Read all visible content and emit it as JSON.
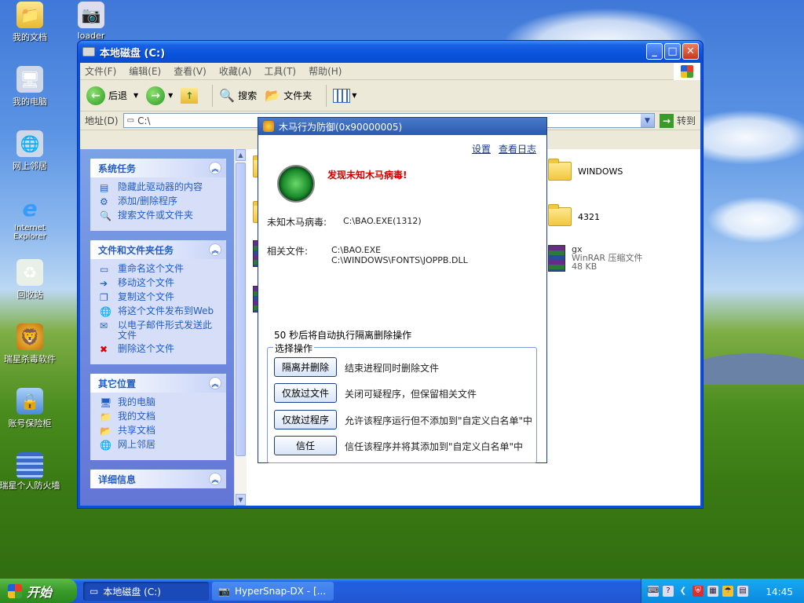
{
  "desktop": {
    "icons": [
      {
        "label": "我的文档",
        "icon": "my-documents-icon"
      },
      {
        "label": "loader",
        "icon": "loader-icon"
      },
      {
        "label": "我的电脑",
        "icon": "my-computer-icon"
      },
      {
        "label": "网上邻居",
        "icon": "network-places-icon"
      },
      {
        "label": "Internet Explorer",
        "icon": "internet-explorer-icon"
      },
      {
        "label": "回收站",
        "icon": "recycle-bin-icon"
      },
      {
        "label": "瑞星杀毒软件",
        "icon": "rising-antivirus-icon"
      },
      {
        "label": "账号保险柜",
        "icon": "account-safe-icon"
      },
      {
        "label": "瑞星个人防火墙",
        "icon": "rising-firewall-icon"
      }
    ]
  },
  "explorer": {
    "title": "本地磁盘 (C:)",
    "menu": [
      "文件(F)",
      "编辑(E)",
      "查看(V)",
      "收藏(A)",
      "工具(T)",
      "帮助(H)"
    ],
    "toolbar": {
      "back": "后退",
      "search": "搜索",
      "folders": "文件夹"
    },
    "address": {
      "label": "地址(D)",
      "value": "C:\\",
      "go": "转到"
    },
    "taskpane": {
      "system_tasks": {
        "title": "系统任务",
        "items": [
          "隐藏此驱动器的内容",
          "添加/删除程序",
          "搜索文件或文件夹"
        ]
      },
      "file_tasks": {
        "title": "文件和文件夹任务",
        "items": [
          "重命名这个文件",
          "移动这个文件",
          "复制这个文件",
          "将这个文件发布到Web",
          "以电子邮件形式发送此文件",
          "删除这个文件"
        ]
      },
      "other_places": {
        "title": "其它位置",
        "items": [
          "我的电脑",
          "我的文档",
          "共享文档",
          "网上邻居"
        ]
      },
      "details": {
        "title": "详细信息"
      }
    },
    "files": [
      {
        "name": "WINDOWS",
        "type": "",
        "size": ""
      },
      {
        "name": "4321",
        "type": "",
        "size": ""
      },
      {
        "name": "gx",
        "type": "WinRAR 压缩文件",
        "size": "48 KB"
      }
    ]
  },
  "dialog": {
    "title": "木马行为防御(0x90000005)",
    "links": {
      "settings": "设置",
      "log": "查看日志"
    },
    "alert": "发现未知木马病毒!",
    "unknown_label": "未知木马病毒:",
    "unknown_value": "C:\\BAO.EXE(1312)",
    "related_label": "相关文件:",
    "related_files": [
      "C:\\BAO.EXE",
      "C:\\WINDOWS\\FONTS\\JOPPB.DLL"
    ],
    "countdown": "50 秒后将自动执行隔离删除操作",
    "group_title": "选择操作",
    "options": [
      {
        "button": "隔离并删除",
        "desc": "结束进程同时删除文件"
      },
      {
        "button": "仅放过文件",
        "desc": "关闭可疑程序，但保留相关文件"
      },
      {
        "button": "仅放过程序",
        "desc": "允许该程序运行但不添加到\"自定义白名单\"中"
      },
      {
        "button": "信任",
        "desc": "信任该程序并将其添加到\"自定义白名单\"中"
      }
    ]
  },
  "taskbar": {
    "start": "开始",
    "tasks": [
      "本地磁盘 (C:)",
      "HyperSnap-DX - [..."
    ],
    "clock": "14:45"
  }
}
